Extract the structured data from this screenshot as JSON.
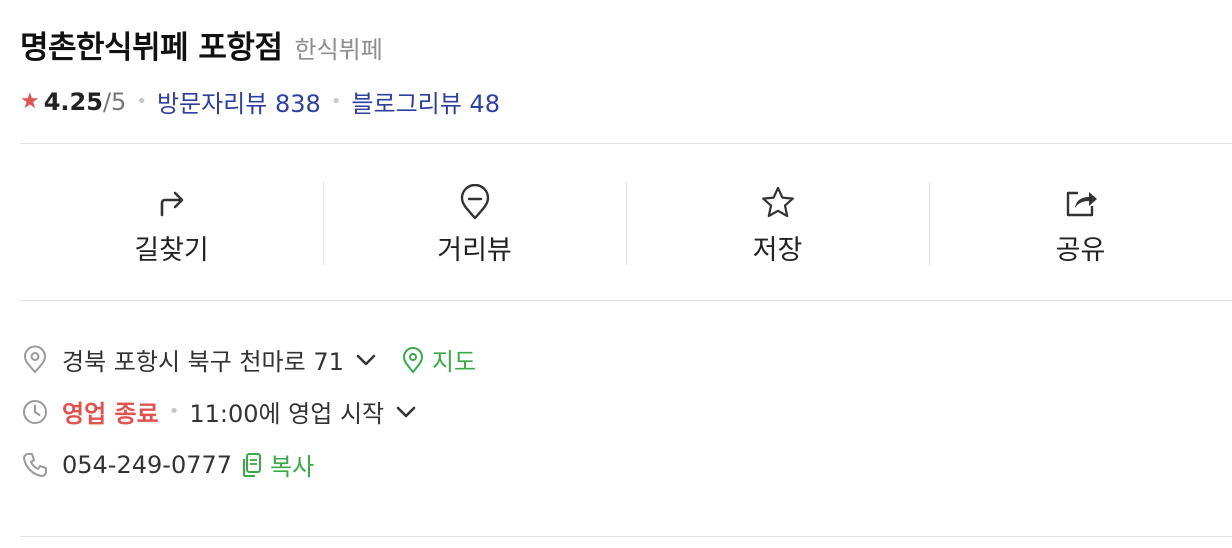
{
  "header": {
    "title": "명촌한식뷔페 포항점",
    "category": "한식뷔페"
  },
  "rating": {
    "score": "4.25",
    "out_of": "/5",
    "visitor_reviews": "방문자리뷰 838",
    "blog_reviews": "블로그리뷰 48"
  },
  "actions": [
    {
      "label": "길찾기",
      "icon": "directions-icon"
    },
    {
      "label": "거리뷰",
      "icon": "street-view-icon"
    },
    {
      "label": "저장",
      "icon": "star-icon"
    },
    {
      "label": "공유",
      "icon": "share-icon"
    }
  ],
  "info": {
    "address": "경북 포항시 북구 천마로 71",
    "map_label": "지도",
    "hours_status": "영업 종료",
    "hours_detail": "11:00에 영업 시작",
    "phone": "054-249-0777",
    "copy_label": "복사"
  },
  "colors": {
    "accent_green": "#3ca84a",
    "closed_red": "#e05250",
    "review_blue": "#2f3f9e"
  }
}
